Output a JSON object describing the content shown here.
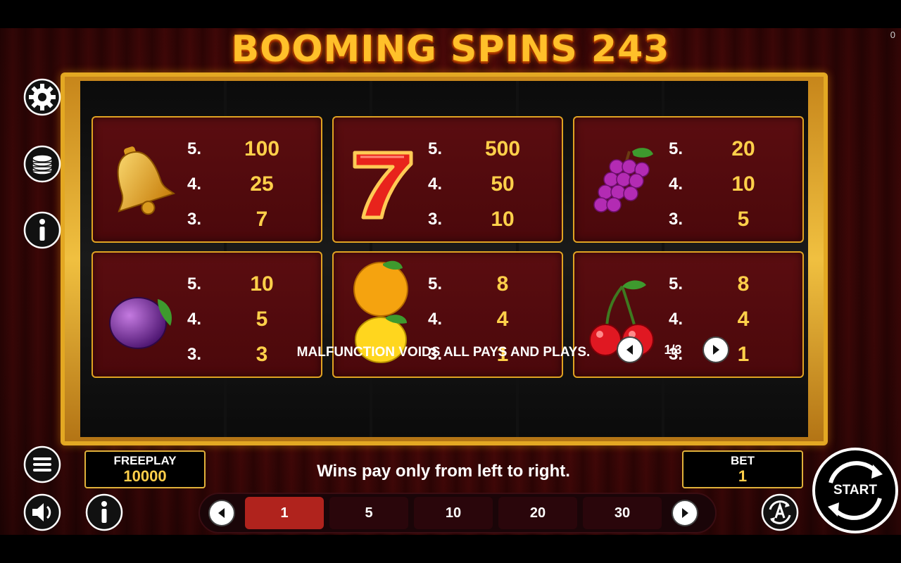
{
  "game": {
    "title": "BOOMING SPINS 243",
    "corner_counter": "0"
  },
  "paytable": [
    {
      "symbol": "bell-icon",
      "rows": [
        {
          "count": "5.",
          "pay": "100"
        },
        {
          "count": "4.",
          "pay": "25"
        },
        {
          "count": "3.",
          "pay": "7"
        }
      ]
    },
    {
      "symbol": "seven-icon",
      "rows": [
        {
          "count": "5.",
          "pay": "500"
        },
        {
          "count": "4.",
          "pay": "50"
        },
        {
          "count": "3.",
          "pay": "10"
        }
      ]
    },
    {
      "symbol": "grapes-icon",
      "rows": [
        {
          "count": "5.",
          "pay": "20"
        },
        {
          "count": "4.",
          "pay": "10"
        },
        {
          "count": "3.",
          "pay": "5"
        }
      ]
    },
    {
      "symbol": "plum-icon",
      "rows": [
        {
          "count": "5.",
          "pay": "10"
        },
        {
          "count": "4.",
          "pay": "5"
        },
        {
          "count": "3.",
          "pay": "3"
        }
      ]
    },
    {
      "symbol": "orange-lemon-icon",
      "rows": [
        {
          "count": "5.",
          "pay": "8"
        },
        {
          "count": "4.",
          "pay": "4"
        },
        {
          "count": "3.",
          "pay": "1"
        }
      ]
    },
    {
      "symbol": "cherries-icon",
      "rows": [
        {
          "count": "5.",
          "pay": "8"
        },
        {
          "count": "4.",
          "pay": "4"
        },
        {
          "count": "3.",
          "pay": "1"
        }
      ]
    }
  ],
  "disclaimer": "MALFUNCTION VOIDS ALL PAYS AND PLAYS.",
  "pager": {
    "label": "1/3"
  },
  "balance": {
    "label": "FREEPLAY",
    "value": "10000"
  },
  "bet": {
    "label": "BET",
    "value": "1"
  },
  "message": "Wins pay only from left to right.",
  "bet_options": [
    "1",
    "5",
    "10",
    "20",
    "30"
  ],
  "selected_bet": "1",
  "start_label": "START",
  "colors": {
    "gold": "#e0a322",
    "payout": "#ffd04a",
    "card_bg": "#4b080b",
    "selected_bet": "#b0231d"
  }
}
